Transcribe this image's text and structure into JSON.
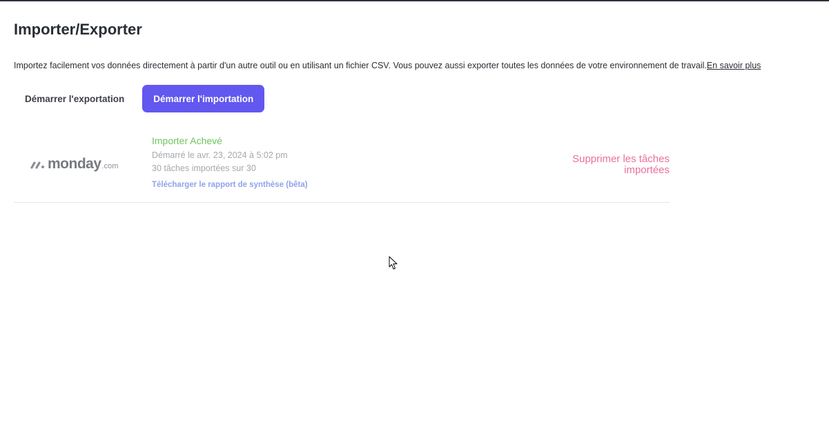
{
  "header": {
    "title": "Importer/Exporter",
    "description": "Importez facilement vos données directement à partir d'un autre outil ou en utilisant un fichier CSV. Vous pouvez aussi exporter toutes les données de votre environnement de travail.",
    "learn_more": "En savoir plus"
  },
  "actions": {
    "export_label": "Démarrer l'exportation",
    "import_label": "Démarrer l'importation"
  },
  "imports": [
    {
      "source_logo_text": "monday",
      "source_logo_suffix": ".com",
      "status": "Importer Achevé",
      "started": "Démarré le avr. 23, 2024 à 5:02 pm",
      "count": "30 tâches importées sur 30",
      "report_link": "Télécharger le rapport de synthèse (bêta)",
      "delete_label": "Supprimer les tâches importées"
    }
  ],
  "colors": {
    "primary": "#6257ef",
    "success": "#6cc65d",
    "danger": "#ea6f9d",
    "link": "#8fa3ea",
    "muted": "#a5a8ad"
  },
  "icons": {
    "logo": "monday-logo-icon",
    "cursor": "mouse-pointer-icon"
  }
}
